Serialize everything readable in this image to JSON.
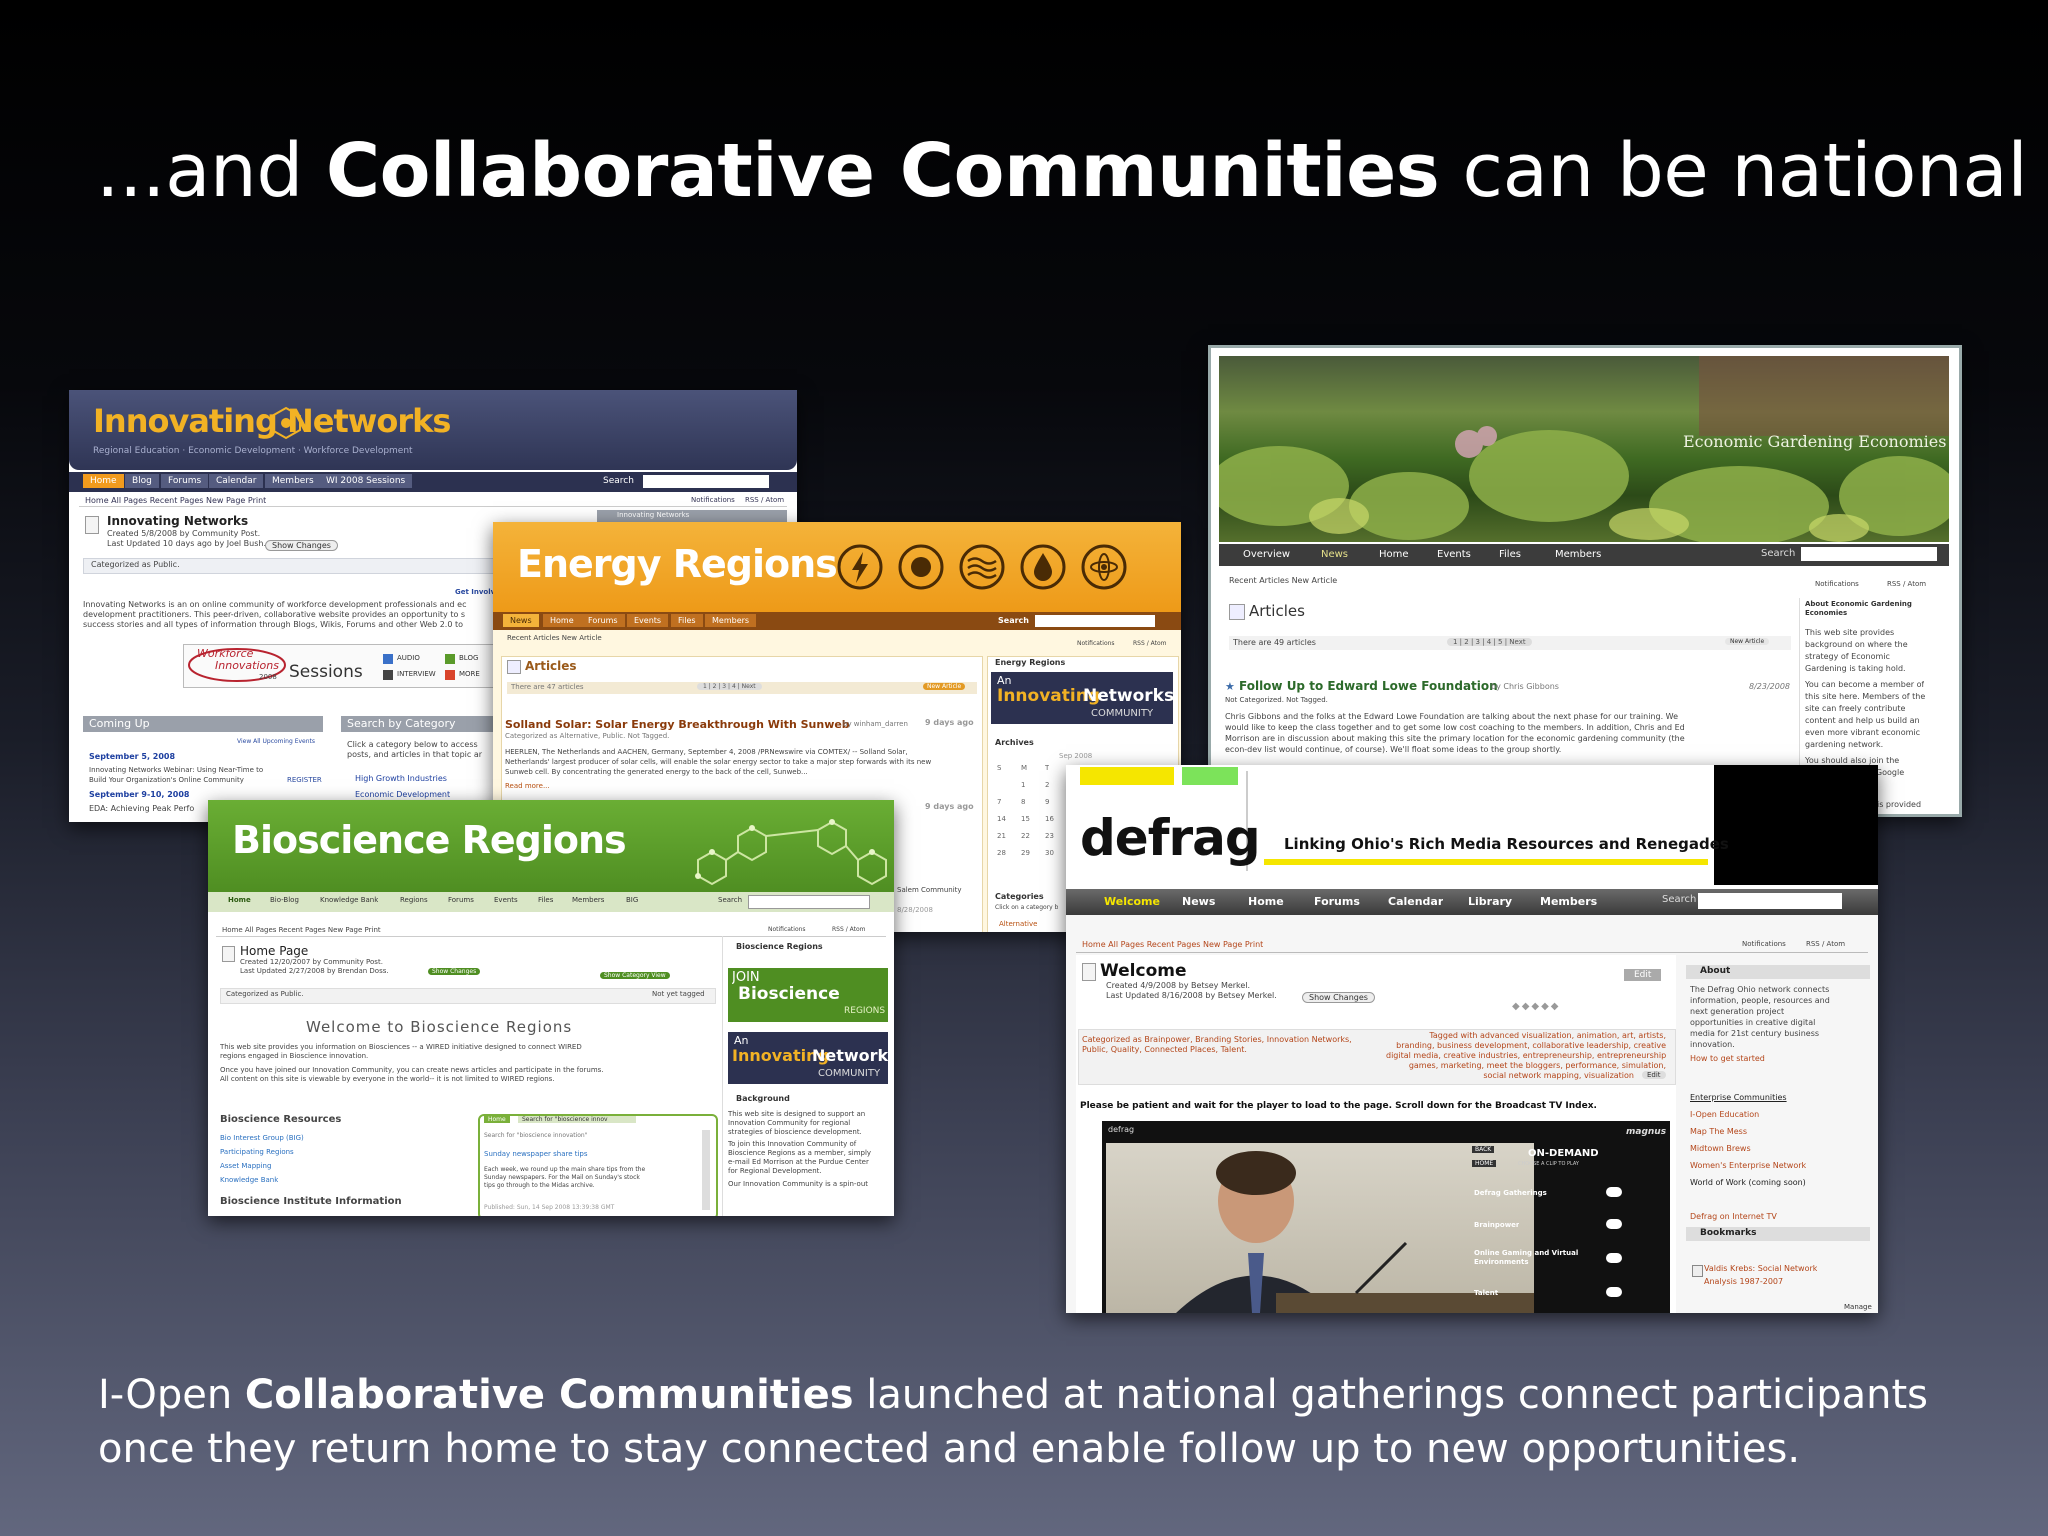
{
  "slide": {
    "title_prefix": "...and ",
    "title_bold": "Collaborative Communities",
    "title_suffix": " can be national",
    "caption_prefix": "I-Open ",
    "caption_bold": "Collaborative Communities",
    "caption_rest1": " launched at national gatherings connect participants",
    "caption_rest2": "once they return home to stay connected and enable follow up to new opportunities."
  },
  "innovating": {
    "logo": "Innovating Networks",
    "tagline": "Regional Education · Economic Development · Workforce Development",
    "tabs": [
      "Home",
      "Blog",
      "Forums",
      "Calendar",
      "Members",
      "WI 2008 Sessions"
    ],
    "search": "Search",
    "subnav": "Home   All Pages   Recent Pages   New Page   Print",
    "notifications": "Notifications",
    "rss": "RSS / Atom",
    "page_title": "Innovating Networks",
    "created": "Created 5/8/2008 by Community Post.",
    "updated": "Last Updated 10 days ago by Joel Bush.",
    "show_changes": "Show Changes",
    "categorized": "Categorized as Public.",
    "get_involved": "Get Involv",
    "body1": "Innovating Networks is an on online community of workforce development professionals and ec",
    "body2": "development practitioners.  This peer-driven, collaborative website provides an opportunity to s",
    "body3": "success stories and all types of information through Blogs, Wikis, Forums and other Web 2.0 to",
    "wi_line1": "Workforce",
    "wi_line2": "Innovations",
    "wi_year": "2008",
    "sessions": "Sessions",
    "audio": "AUDIO",
    "blog": "BLOG",
    "interview": "INTERVIEW",
    "more": "MORE",
    "coming_up": "Coming Up",
    "view_all": "View All Upcoming Events",
    "date1": "September 5, 2008",
    "ev1a": "Innovating Networks Webinar: Using Near-Time to",
    "ev1b": "Build Your Organization's Online Community",
    "register": "REGISTER",
    "date2": "September 9-10, 2008",
    "ev2": "EDA: Achieving Peak Perfo",
    "search_cat": "Search by Category",
    "cat_desc1": "Click a category below to access",
    "cat_desc2": "posts, and articles in that topic ar",
    "cat1": "High Growth Industries",
    "cat2": "Economic Development",
    "right_panel": "Innovating Networks"
  },
  "energy": {
    "title": "Energy Regions",
    "tabs": [
      "News",
      "Home",
      "Forums",
      "Events",
      "Files",
      "Members"
    ],
    "search": "Search",
    "subnav": "Recent Articles   New Article",
    "notifications": "Notifications",
    "rss": "RSS / Atom",
    "articles": "Articles",
    "count": "There are 47 articles",
    "pager": "1 | 2 | 3 | 4 | Next",
    "new_article": "New Article",
    "headline": "Solland Solar: Solar Energy Breakthrough With Sunweb",
    "by": "by winham_darren",
    "ago": "9 days ago",
    "categorized": "Categorized as Alternative, Public. Not Tagged.",
    "body1": "HEERLEN, The Netherlands and AACHEN, Germany, September 4, 2008 /PRNewswire via COMTEX/ -- Solland Solar,",
    "body2": "Netherlands' largest producer of solar cells, will enable the solar energy sector to take a major step forwards with its new",
    "body3": "Sunweb cell. By concentrating the generated energy to the back of the cell, Sunweb...",
    "read_more": "Read more...",
    "ago2": "9 days ago",
    "side_head": "Energy Regions",
    "in_an": "An",
    "in_innovating": "Innovating",
    "in_networks": "Networks",
    "in_community": "COMMUNITY",
    "archives": "Archives",
    "month": "Sep 2008",
    "cal_head": [
      "S",
      "M",
      "T"
    ],
    "cal_rows": [
      [
        "",
        "1",
        "2"
      ],
      [
        "7",
        "8",
        "9"
      ],
      [
        "14",
        "15",
        "16"
      ],
      [
        "21",
        "22",
        "23"
      ],
      [
        "28",
        "29",
        "30"
      ]
    ],
    "categories": "Categories",
    "cat_hint": "Click on a category b",
    "cat_item": "Alternative",
    "cat_item2": "Community C",
    "salem": "Salem Community",
    "date_frag": "8/28/2008"
  },
  "bio": {
    "title": "Bioscience Regions",
    "tabs": [
      "Home",
      "Bio-Blog",
      "Knowledge Bank",
      "Regions",
      "Forums",
      "Events",
      "Files",
      "Members",
      "BIG"
    ],
    "search": "Search",
    "subnav": "Home   All Pages   Recent Pages   New Page   Print",
    "notifications": "Notifications",
    "rss": "RSS / Atom",
    "page_title": "Home Page",
    "created": "Created 12/20/2007 by Community Post.",
    "updated": "Last Updated 2/27/2008 by Brendan Doss.",
    "show_changes": "Show Changes",
    "show_cat": "Show Category View",
    "categorized": "Categorized as Public.",
    "not_tagged": "Not yet tagged",
    "welcome": "Welcome to Bioscience Regions",
    "p1": "This web site provides you information on Biosciences -- a WIRED initiative designed to connect WIRED",
    "p2": "regions engaged in Bioscience innovation.",
    "p3": "Once you have joined our Innovation Community, you can create news articles and participate in the forums.",
    "p4": "All content on this site is viewable by everyone in the world-- it is not limited to WIRED regions.",
    "resources": "Bioscience Resources",
    "res": [
      "Bio Interest Group (BIG)",
      "Participating Regions",
      "Asset Mapping",
      "Knowledge Bank"
    ],
    "institute": "Bioscience Institute Information",
    "mini_tab1": "Home",
    "mini_tab2": "Search for \"bioscience innov",
    "mini_search": "Search for \"bioscience innovation\"",
    "mini_head": "Sunday newspaper share tips",
    "mini_body1": "Each week, we round up the main share tips from the",
    "mini_body2": "Sunday newspapers. For the Mail on Sunday's stock",
    "mini_body3": "tips go through to the Midas archive.",
    "mini_pub": "Published: Sun, 14 Sep 2008 13:39:38 GMT",
    "side_head": "Bioscience Regions",
    "join": "JOIN",
    "bioscience": "Bioscience",
    "regions": "REGIONS",
    "in_an": "An",
    "in_innovating": "Innovating",
    "in_networks": "Networks",
    "in_community": "COMMUNITY",
    "background": "Background",
    "bg1": "This web site is designed to support an",
    "bg2": "Innovation Community for regional",
    "bg3": "strategies of bioscience development.",
    "bg4": "To join this Innovation Community of",
    "bg5": "Bioscience Regions as a member, simply",
    "bg6": "e-mail Ed Morrison at  the Purdue Center",
    "bg7": "for Regional Development.",
    "bg8": "Our Innovation Community  is a spin-out"
  },
  "garden": {
    "banner": "Economic Gardening Economies",
    "tabs": [
      "Overview",
      "News",
      "Home",
      "Events",
      "Files",
      "Members"
    ],
    "search": "Search",
    "subnav": "Recent Articles   New Article",
    "notifications": "Notifications",
    "rss": "RSS / Atom",
    "articles": "Articles",
    "count": "There are 49 articles",
    "pager": "1 | 2 | 3 | 4 | 5 | Next",
    "new_article": "New Article",
    "headline": "Follow Up to Edward Lowe Foundation",
    "by": "by Chris Gibbons",
    "date": "8/23/2008",
    "not_cat1": "Not Categorized. Not Tagged.",
    "body1": "Chris Gibbons and the folks at the Edward Lowe Foundation are talking about the next phase for our training.  We",
    "body2": "would like to keep the class together and to get some low cost coaching to the members.  In addition, Chris and Ed",
    "body3": "Morrison are in discussion about making this site the primary location for the economic gardening community (the",
    "body4": "econ-dev list would continue, of course).  We'll float some ideas to the group shortly.",
    "about": "About Economic Gardening Economies",
    "about_text": [
      "This web site provides",
      "background on where the",
      "strategy of Economic",
      "Gardening is taking hold.",
      "You can become a member of",
      "this site here. Members of the",
      "site can freely contribute",
      "content and help us build an",
      "even more vibrant economic",
      "gardening network.",
      "You should also join the",
      "ing Google",
      "is provided"
    ]
  },
  "defrag": {
    "logo": "defrag",
    "tagline": "Linking Ohio's Rich Media Resources and Renegades",
    "tabs": [
      "Welcome",
      "News",
      "Home",
      "Forums",
      "Calendar",
      "Library",
      "Members"
    ],
    "search": "Search",
    "subnav": "Home   All Pages   Recent Pages   New Page   Print",
    "notifications": "Notifications",
    "rss": "RSS / Atom",
    "page_title": "Welcome",
    "edit": "Edit",
    "created": "Created 4/9/2008 by Betsey Merkel.",
    "updated": "Last Updated 8/16/2008 by Betsey Merkel.",
    "show_changes": "Show Changes",
    "categorized": "Categorized as Brainpower, Branding Stories, Innovation Networks, Public, Quality, Connected Places, Talent.",
    "tagged1": "Tagged with advanced visualization, animation, art, artists,",
    "tagged2": "branding, business development, collaborative leadership, creative",
    "tagged3": "digital media, creative industries, entrepreneurship, entrepreneurship,",
    "tagged4": "games, marketing, meet the bloggers, performance, simulation,",
    "tagged5": "social network mapping, visualization",
    "edit_small": "Edit",
    "notice": "Please be patient and wait for the player to load to the page. Scroll down for the Broadcast TV Index.",
    "player_label": "defrag",
    "player_brand": "magnus",
    "back": "BACK",
    "home": "HOME",
    "on_demand": "ON-DEMAND",
    "choose": "CHOOSE A CLIP TO PLAY",
    "clips": [
      "Defrag Gatherings",
      "Brainpower",
      "Online Gaming and Virtual Environments",
      "Talent"
    ],
    "about": "About",
    "about_text": [
      "The Defrag Ohio network connects",
      "information, people, resources and",
      "next generation project",
      "opportunities in creative digital",
      "media for 21st century business",
      "innovation."
    ],
    "how_to": "How to get started",
    "links": [
      "Enterprise Communities",
      "I-Open Education",
      "Map The Mess",
      "Midtown Brews",
      "Women's Enterprise Network",
      "World of Work (coming soon)"
    ],
    "defrag_tv": "Defrag on Internet TV",
    "bookmarks": "Bookmarks",
    "bm1": "Valdis Krebs: Social Network",
    "bm2": "Analysis 1987-2007",
    "manage": "Manage"
  },
  "colors": {
    "innov_header": "#3d4468",
    "energy_orange": "#f0a020",
    "bio_green": "#5a9a2a",
    "garden_gray": "#3c3c3c",
    "defrag_yellow": "#f5e600",
    "defrag_green": "#7ce35a"
  }
}
